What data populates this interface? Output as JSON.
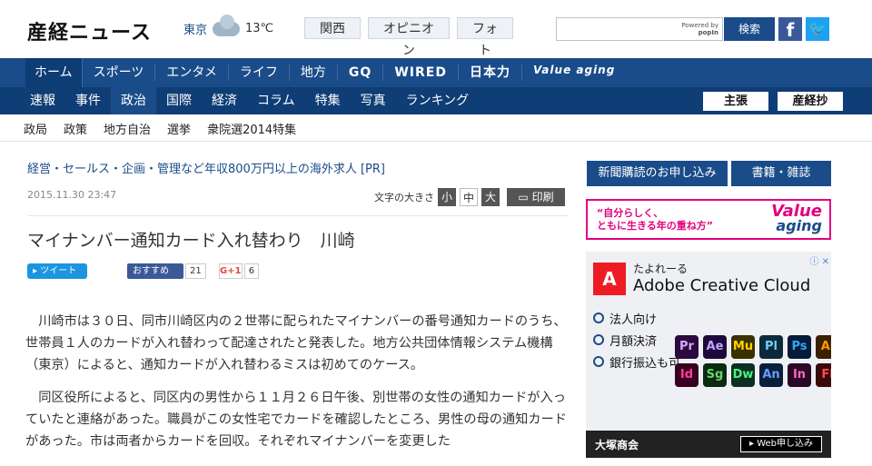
{
  "header": {
    "logo_text": "産経ニュース",
    "weather_city": "東京",
    "weather_temp": "13℃",
    "region_tabs": [
      "関西",
      "オピニオン",
      "フォト"
    ],
    "search_placeholder": "",
    "powered_by": "Powered by",
    "popin": "popIn",
    "search_button": "検索",
    "facebook": "f",
    "twitter": "t"
  },
  "nav_main": {
    "items": [
      "ホーム",
      "スポーツ",
      "エンタメ",
      "ライフ",
      "地方",
      "GQ",
      "WIRED",
      "日本力",
      "Value aging"
    ],
    "active": "ホーム"
  },
  "nav_sub": {
    "items": [
      "速報",
      "事件",
      "政治",
      "国際",
      "経済",
      "コラム",
      "特集",
      "写真",
      "ランキング"
    ],
    "active": "政治",
    "right_buttons": [
      "主張",
      "産経抄"
    ]
  },
  "nav_third": {
    "items": [
      "政局",
      "政策",
      "地方自治",
      "選挙",
      "衆院選2014特集"
    ]
  },
  "article": {
    "pr_text": "経営・セールス・企画・管理など年収800万円以上の海外求人 [PR]",
    "date": "2015.11.30 23:47",
    "font_size_label": "文字の大きさ",
    "font_sizes": [
      "小",
      "中",
      "大"
    ],
    "print_label": "印刷",
    "title": "マイナンバー通知カード入れ替わり　川崎",
    "tweet_label": "ツイート",
    "fb_label": "おすすめ",
    "fb_count": "21",
    "gplus_label": "G+1",
    "gplus_count": "6",
    "paragraphs": [
      "川崎市は３０日、同市川崎区内の２世帯に配られたマイナンバーの番号通知カードのうち、世帯員１人のカードが入れ替わって配達されたと発表した。地方公共団体情報システム機構（東京）によると、通知カードが入れ替わるミスは初めてのケース。",
      "同区役所によると、同区内の男性から１１月２６日午後、別世帯の女性の通知カードが入っていたと連絡があった。職員がこの女性宅でカードを確認したところ、男性の母の通知カードがあった。市は両者からカードを回収。それぞれマイナンバーを変更した"
    ]
  },
  "sidebar": {
    "btn_subscribe": "新聞購読のお申し込み",
    "btn_books": "書籍・雑誌",
    "banner_line1": "“自分らしく、",
    "banner_line2": "ともに生きる年の重ね方”",
    "banner_brand1": "Value",
    "banner_brand2": "aging",
    "ad_close": "ⓘ ✕",
    "ad_logo": "A",
    "ad_title_small": "たよれーる",
    "ad_title_big": "Adobe Creative Cloud",
    "ad_list": [
      "法人向け",
      "月額決済",
      "銀行振込も可"
    ],
    "ad_tiles": [
      "Pr",
      "Ae",
      "Mu",
      "Pl",
      "Ps",
      "Ai",
      "Id",
      "Sg",
      "Dw",
      "An",
      "In",
      "Fl"
    ],
    "ad_company": "大塚商会",
    "ad_cta": "▸ Web申し込み"
  },
  "colors": {
    "brand_blue": "#1a4c8a",
    "nav_dark": "#0f3d75",
    "pink": "#e3007f"
  }
}
